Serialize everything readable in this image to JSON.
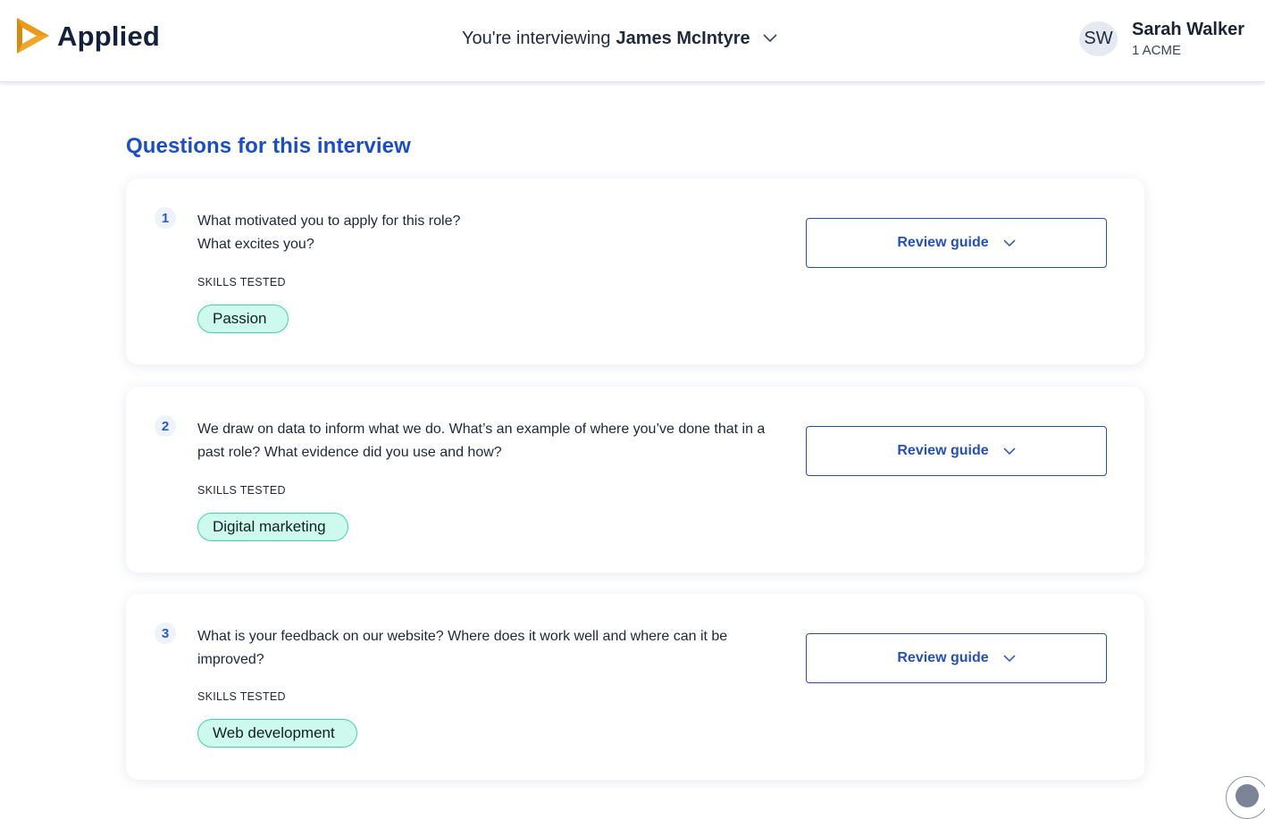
{
  "header": {
    "brand": "Applied",
    "interviewing_prefix": "You're interviewing",
    "candidate_name": "James McIntyre",
    "user": {
      "initials": "SW",
      "name": "Sarah Walker",
      "org": "1 ACME"
    }
  },
  "main": {
    "section_title": "Questions for this interview",
    "questions": [
      {
        "number": "1",
        "text_lines": [
          "What motivated you to apply for this role?",
          "What excites you?"
        ],
        "skills_label": "SKILLS TESTED",
        "skill": "Passion",
        "review_label": "Review guide"
      },
      {
        "number": "2",
        "text_lines": [
          "We draw on data to inform what we do. What’s an example of where you’ve done that in a past role? What evidence did you use and how?"
        ],
        "skills_label": "SKILLS TESTED",
        "skill": "Digital marketing",
        "review_label": "Review guide"
      },
      {
        "number": "3",
        "text_lines": [
          "What is your feedback on our website? Where does it work well and where can it be improved?"
        ],
        "skills_label": "SKILLS TESTED",
        "skill": "Web development",
        "review_label": "Review guide"
      }
    ]
  },
  "colors": {
    "accent": "#1b4fc0",
    "pill_bg": "#cdfaec",
    "pill_border": "#3fd5a6",
    "logo_orange": "#f5a623"
  },
  "icons": {
    "logo": "applied-play-logo-icon",
    "dropdown": "chevron-down-icon",
    "help": "help-icon"
  }
}
